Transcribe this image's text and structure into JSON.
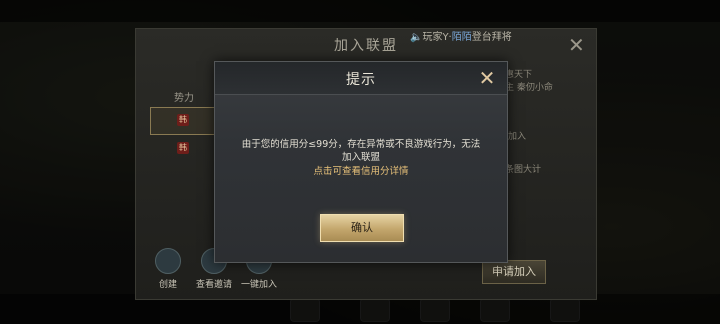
{
  "dialog": {
    "title": "提示",
    "message": "由于您的信用分≤99分，存在异常或不良游戏行为，无法加入联盟",
    "link": "点击可查看信用分详情",
    "confirm": "确认",
    "close_glyph": "✕"
  },
  "alliance": {
    "title": "加入联盟",
    "close_glyph": "✕",
    "table_header": "势力",
    "row_badge": "韩",
    "notice_prefix": "🔈玩家Y·",
    "notice_highlight": "陌陌",
    "notice_suffix": "登台拜将",
    "side_1": "惠天下",
    "side_2": "主 秦仞小命",
    "side_3": "加入",
    "side_4": "条图大计",
    "actions": [
      {
        "label": "创建"
      },
      {
        "label": "查看邀请"
      },
      {
        "label": "一键加入"
      }
    ],
    "apply": "申请加入"
  }
}
